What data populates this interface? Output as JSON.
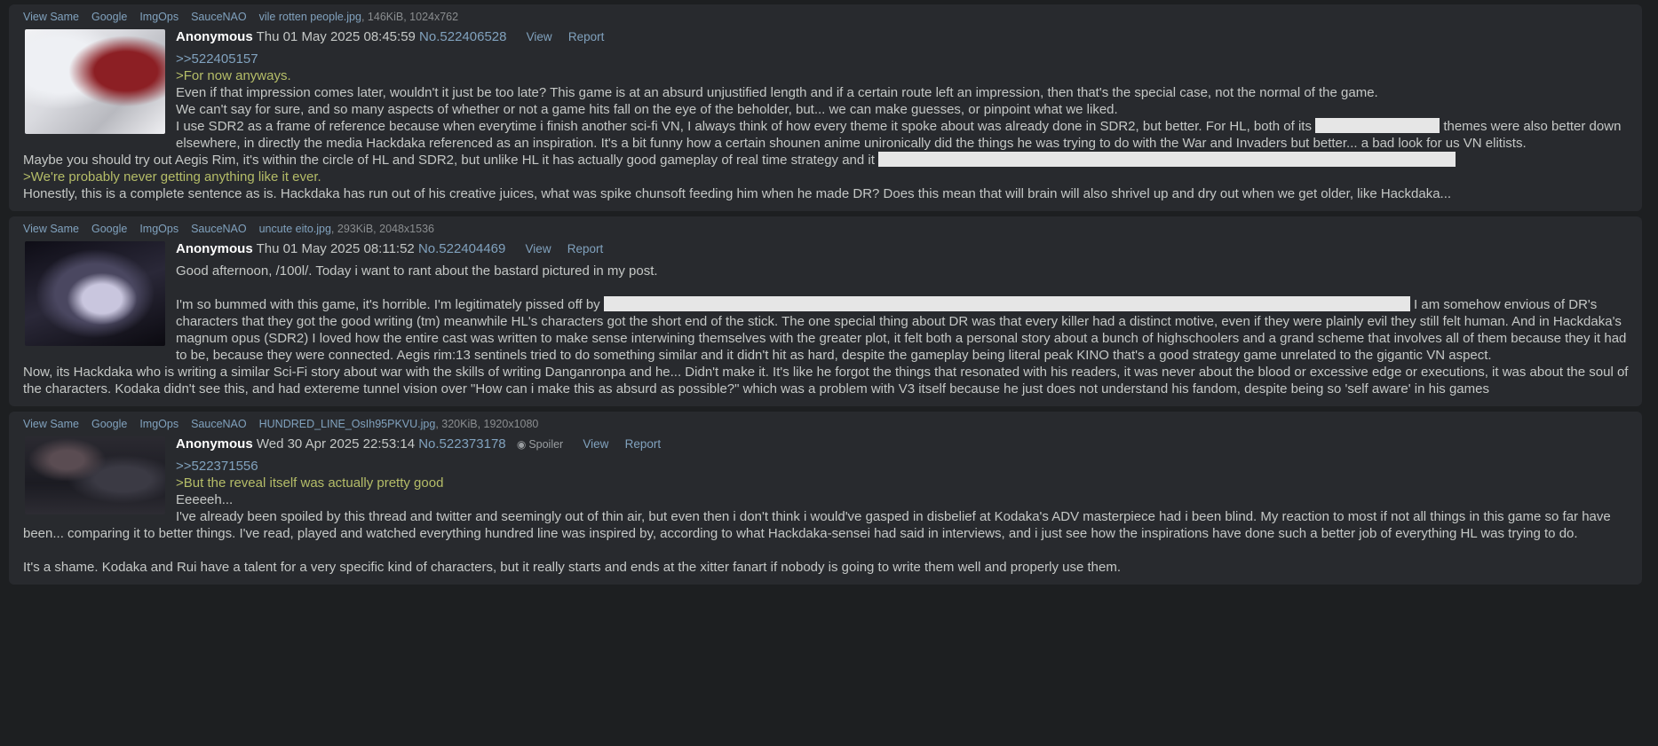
{
  "file_links": {
    "view_same": "View Same",
    "google": "Google",
    "imgops": "ImgOps",
    "saucenao": "SauceNAO"
  },
  "actions": {
    "view": "View",
    "report": "Report",
    "spoiler": "Spoiler"
  },
  "posts": [
    {
      "filename": "vile rotten people.jpg",
      "filemeta": ", 146KiB, 1024x762",
      "name": "Anonymous",
      "date": "Thu 01 May 2025 08:45:59",
      "postno": "No.522406528",
      "quote_ref": ">>522405157",
      "green1": ">For now anyways.",
      "line1": "Even if that impression comes later, wouldn't it just be too late? This game is at an absurd unjustified length and if a certain route left an impression, then that's the special case, not the normal of the game.",
      "line2": "We can't say for sure, and so many aspects of whether or not a game hits fall on the eye of the beholder, but... we can make guesses, or pinpoint what we liked.",
      "line3a": "I use SDR2 as a frame of reference because when everytime i finish another sci-fi VN, I always think of how every theme it spoke about was already done in SDR2, but better. For HL, both of its",
      "line3b": "themes were also better down elsewhere, in directly the media Hackdaka referenced as an inspiration. It's a bit funny how a certain shounen anime unironically did the things he was trying to do with the War and Invaders but better... a bad look for us VN elitists.",
      "line4a": "Maybe you should try out Aegis Rim, it's within the circle of HL and SDR2, but unlike HL it has actually good gameplay of real time strategy and it",
      "green2": ">We're probably never getting anything like it ever.",
      "line5": "Honestly, this is a complete sentence as is. Hackdaka has run out of his creative juices, what was spike chunsoft feeding him when he made DR? Does this mean that will brain will also shrivel up and dry out when we get older, like Hackdaka..."
    },
    {
      "filename": "uncute eito.jpg",
      "filemeta": ", 293KiB, 2048x1536",
      "name": "Anonymous",
      "date": "Thu 01 May 2025 08:11:52",
      "postno": "No.522404469",
      "line1": "Good afternoon, /100l/. Today i want to rant about the bastard pictured in my post.",
      "line2a": "I'm so bummed with this game, it's horrible. I'm legitimately pissed off by",
      "line2b": "I am somehow envious of DR's characters that they got the good writing (tm) meanwhile HL's characters got the short end of the stick. The one special thing about DR was that every killer had a distinct motive, even if they were plainly evil they still felt human. And in Hackdaka's magnum opus (SDR2) I loved how the entire cast was written to make sense interwining themselves with the greater plot, it felt both a personal story about a bunch of highschoolers and a grand scheme that involves all of them because they it had to be, because they were connected. Aegis rim:13 sentinels tried to do something similar and it didn't hit as hard, despite the gameplay being literal peak KINO that's a good strategy game unrelated to the gigantic VN aspect.",
      "line3": "Now, its Hackdaka who is writing a similar Sci-Fi story about war with the skills of writing Danganronpa and he... Didn't make it. It's like he forgot the things that resonated with his readers, it was never about the blood or excessive edge or executions, it was about the soul of the characters. Kodaka didn't see this, and had extereme tunnel vision over \"How can i make this as absurd as possible?\" which was a problem with V3 itself because he just does not understand his fandom, despite being so 'self aware' in his games"
    },
    {
      "filename": "HUNDRED_LINE_OsIh95PKVU.jpg",
      "filemeta": ", 320KiB, 1920x1080",
      "name": "Anonymous",
      "date": "Wed 30 Apr 2025 22:53:14",
      "postno": "No.522373178",
      "quote_ref": ">>522371556",
      "green1": ">But the reveal itself was actually pretty good",
      "line1": "Eeeeeh...",
      "line2": "I've already been spoiled by this thread and twitter and seemingly out of thin air, but even then i don't think i would've gasped in disbelief at Kodaka's ADV masterpiece had i been blind. My reaction to most if not all things in this game so far have been... comparing it to better things. I've read, played and watched everything hundred line was inspired by, according to what Hackdaka-sensei had said in interviews, and i just see how the inspirations have done such a better job of everything HL was trying to do.",
      "line3": "It's a shame. Kodaka and Rui have a talent for a very specific kind of characters, but it really starts and ends at the xitter fanart if nobody is going to write them well and properly use them."
    }
  ]
}
